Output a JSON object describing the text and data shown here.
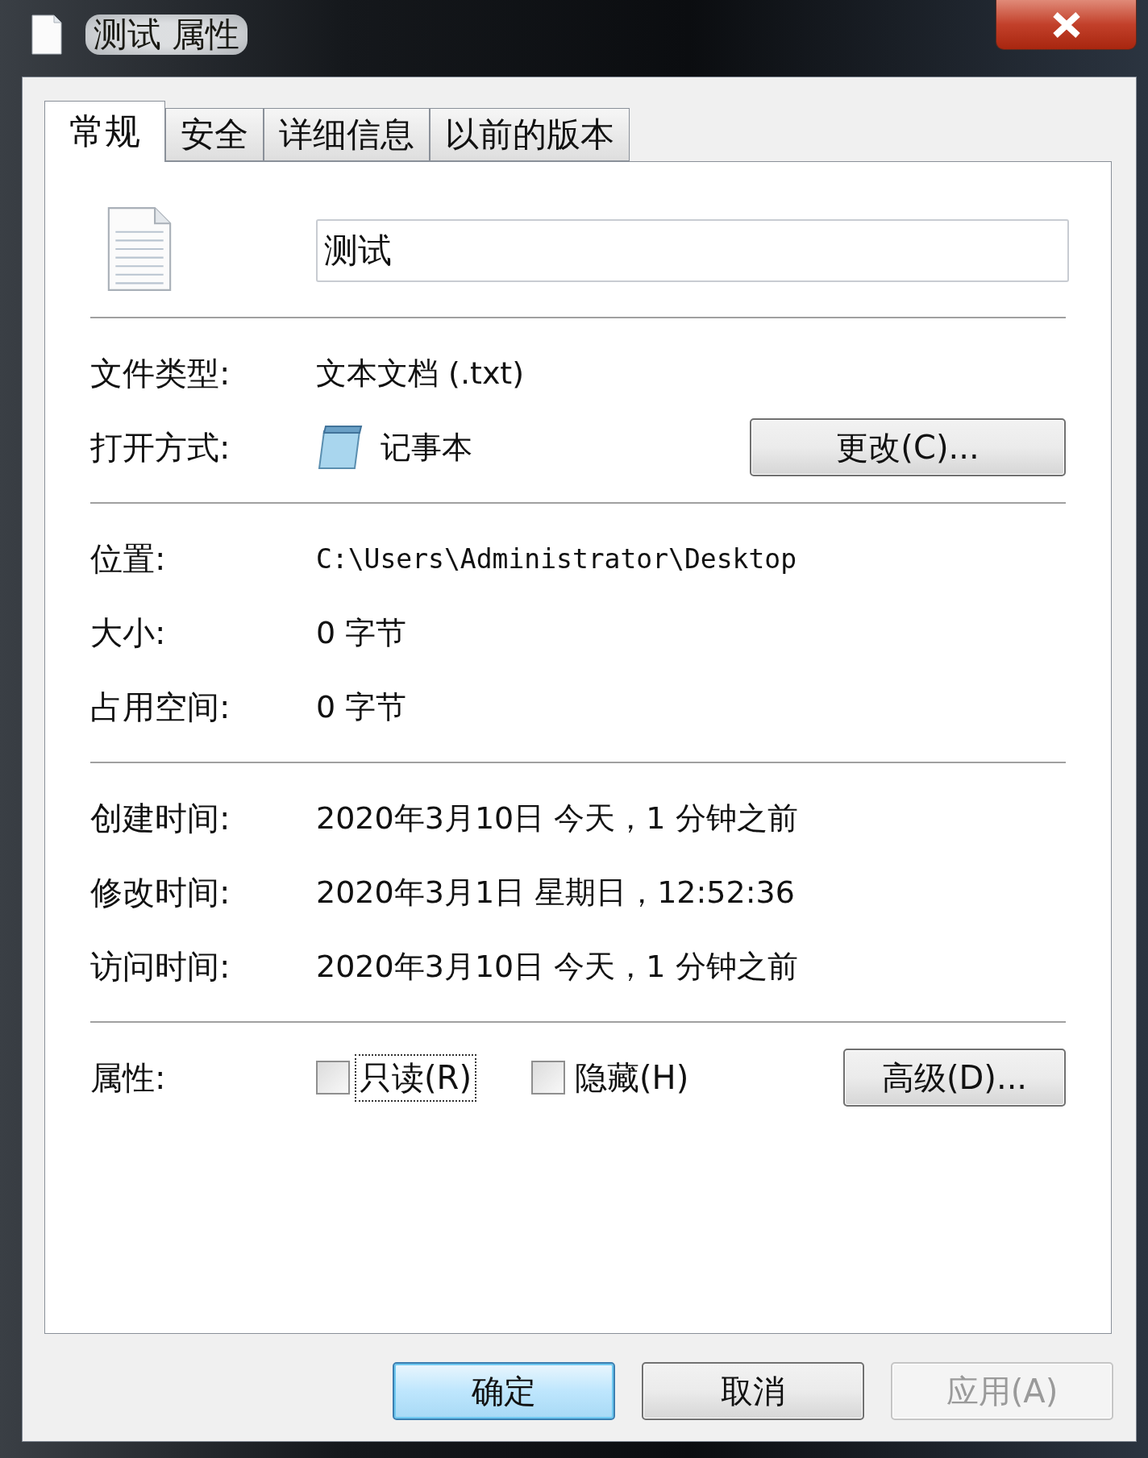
{
  "window": {
    "title": "测试 属性"
  },
  "tabs": [
    {
      "label": "常规",
      "selected": true
    },
    {
      "label": "安全",
      "selected": false
    },
    {
      "label": "详细信息",
      "selected": false
    },
    {
      "label": "以前的版本",
      "selected": false
    }
  ],
  "file_name": "测试",
  "sections": [
    [
      {
        "kind": "text",
        "label": "文件类型:",
        "value": "文本文档 (.txt)"
      },
      {
        "kind": "app",
        "label": "打开方式:",
        "value": "记事本",
        "button": "更改(C)..."
      }
    ],
    [
      {
        "kind": "mono",
        "label": "位置:",
        "value": "C:\\Users\\Administrator\\Desktop"
      },
      {
        "kind": "text",
        "label": "大小:",
        "value": "0 字节"
      },
      {
        "kind": "text",
        "label": "占用空间:",
        "value": "0 字节"
      }
    ],
    [
      {
        "kind": "text",
        "label": "创建时间:",
        "value": "2020年3月10日 今天，1 分钟之前"
      },
      {
        "kind": "text",
        "label": "修改时间:",
        "value": "2020年3月1日 星期日，12:52:36"
      },
      {
        "kind": "text",
        "label": "访问时间:",
        "value": "2020年3月10日 今天，1 分钟之前"
      }
    ],
    [
      {
        "kind": "attributes",
        "label": "属性:",
        "checkboxes": [
          {
            "label": "只读(R)",
            "checked": false,
            "focused": true
          },
          {
            "label": "隐藏(H)",
            "checked": false,
            "focused": false
          }
        ],
        "button": "高级(D)..."
      }
    ]
  ],
  "buttons": [
    {
      "label": "确定",
      "kind": "default",
      "disabled": false
    },
    {
      "label": "取消",
      "kind": "normal",
      "disabled": false
    },
    {
      "label": "应用(A)",
      "kind": "normal",
      "disabled": true
    }
  ]
}
